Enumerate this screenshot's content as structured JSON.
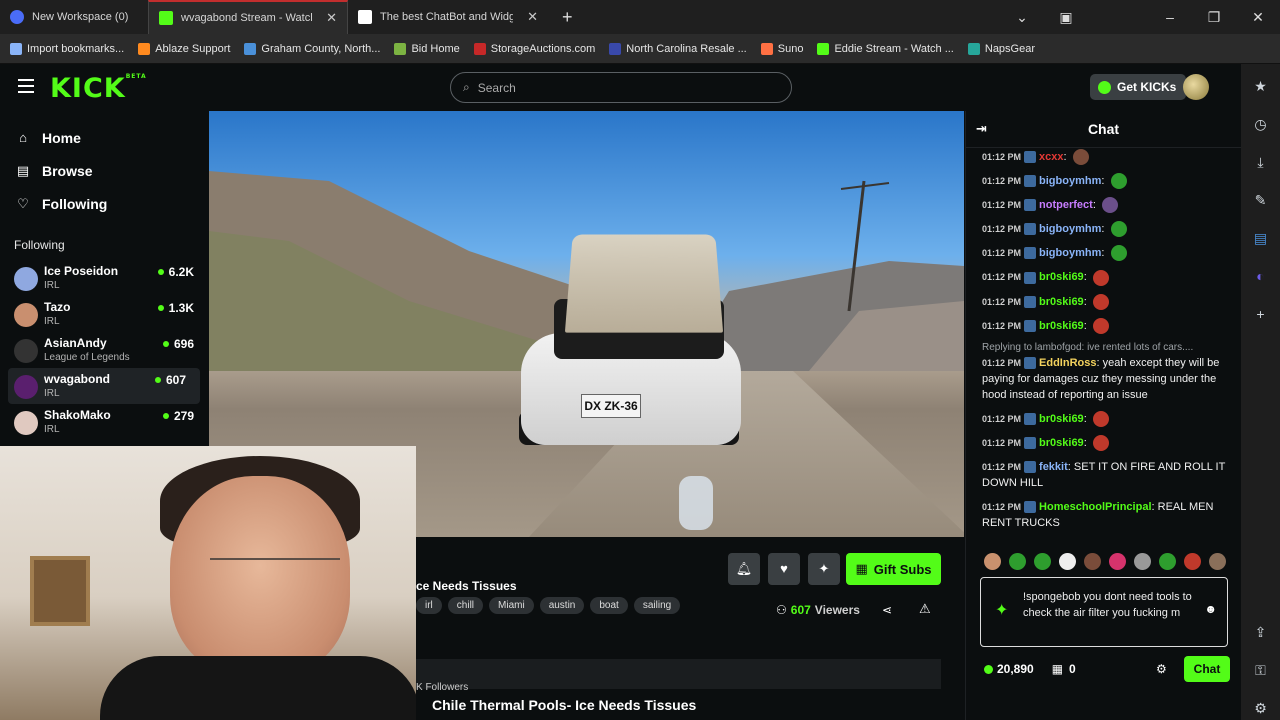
{
  "browser": {
    "tabs": [
      {
        "title": "New Workspace (0)",
        "active": false
      },
      {
        "title": "wvagabond Stream - Watch Liv",
        "active": true
      },
      {
        "title": "The best ChatBot and Widgets fo",
        "active": false
      }
    ],
    "new_tab": "+",
    "bookmarks": [
      {
        "label": "Import bookmarks...",
        "color": "#8ab4f8"
      },
      {
        "label": "Ablaze Support",
        "color": "#ff8a1f"
      },
      {
        "label": "Graham County, North...",
        "color": "#4a90d9"
      },
      {
        "label": "Bid Home",
        "color": "#7cb342"
      },
      {
        "label": "StorageAuctions.com",
        "color": "#c62828"
      },
      {
        "label": "North Carolina Resale ...",
        "color": "#3949ab"
      },
      {
        "label": "Suno",
        "color": "#ff7043"
      },
      {
        "label": "Eddie Stream - Watch ...",
        "color": "#53fc18"
      },
      {
        "label": "NapsGear",
        "color": "#26a69a"
      }
    ]
  },
  "header": {
    "logo": "KICK",
    "logo_sup": "BETA",
    "search_placeholder": "Search",
    "get_kicks": "Get KICKs",
    "accent": "#53fc18"
  },
  "sidebar": {
    "nav": [
      {
        "label": "Home",
        "icon": "home-icon"
      },
      {
        "label": "Browse",
        "icon": "browse-icon"
      },
      {
        "label": "Following",
        "icon": "heart-icon"
      }
    ],
    "following_title": "Following",
    "channels": [
      {
        "name": "Ice Poseidon",
        "category": "IRL",
        "viewers": "6.2K",
        "avatar": "#8fa8e0"
      },
      {
        "name": "Tazo",
        "category": "IRL",
        "viewers": "1.3K",
        "avatar": "#c98f6f"
      },
      {
        "name": "AsianAndy",
        "category": "League of Legends",
        "viewers": "696",
        "avatar": "#333"
      },
      {
        "name": "wvagabond",
        "category": "IRL",
        "viewers": "607",
        "avatar": "#5a1f6e"
      },
      {
        "name": "ShakoMako",
        "category": "IRL",
        "viewers": "279",
        "avatar": "#e0c9c0"
      }
    ]
  },
  "video": {
    "plate": "DX ZK-36"
  },
  "stream": {
    "title_fragment": "ce Needs Tissues",
    "tags": [
      "irl",
      "chill",
      "Miami",
      "austin",
      "boat",
      "sailing"
    ],
    "gift_subs": "Gift Subs",
    "viewers_count": "607",
    "viewers_label": "Viewers",
    "followers_fragment": "K Followers",
    "bottom_title": "Chile Thermal Pools- Ice Needs Tissues"
  },
  "chat": {
    "title": "Chat",
    "messages": [
      {
        "time": "01:12 PM",
        "user": "xcxx",
        "color": "#e53935",
        "text": "",
        "emote": "#7a4c3a"
      },
      {
        "time": "01:12 PM",
        "user": "bigboymhm",
        "color": "#8ab4f8",
        "text": "",
        "emote": "#2e9e2e",
        "sep": ":"
      },
      {
        "time": "01:12 PM",
        "user": "notperfect",
        "color": "#c77dff",
        "text": "",
        "emote": "#6b4f8a",
        "sep": ":"
      },
      {
        "time": "01:12 PM",
        "user": "bigboymhm",
        "color": "#8ab4f8",
        "text": "",
        "emote": "#2e9e2e",
        "sep": ":"
      },
      {
        "time": "01:12 PM",
        "user": "bigboymhm",
        "color": "#8ab4f8",
        "text": "",
        "emote": "#2e9e2e",
        "sep": ":"
      },
      {
        "time": "01:12 PM",
        "user": "br0ski69",
        "color": "#53fc18",
        "text": "",
        "emote": "#c0392b",
        "sep": ":"
      },
      {
        "time": "01:12 PM",
        "user": "br0ski69",
        "color": "#53fc18",
        "text": "",
        "emote": "#c0392b",
        "sep": ":"
      },
      {
        "time": "01:12 PM",
        "user": "br0ski69",
        "color": "#53fc18",
        "text": "",
        "emote": "#c0392b",
        "sep": ":"
      }
    ],
    "reply_note": "Replying to lambofgod: ive rented lots of cars....",
    "message_long": {
      "time": "01:12 PM",
      "user": "EddInRoss",
      "color": "#f4d35e",
      "text": "yeah except they will be paying for damages cuz they messing under the hood instead of reporting an issue"
    },
    "messages_after": [
      {
        "time": "01:12 PM",
        "user": "br0ski69",
        "color": "#53fc18",
        "text": "",
        "sep": ":"
      },
      {
        "time": "01:12 PM",
        "user": "br0ski69",
        "color": "#53fc18",
        "text": "",
        "sep": ":"
      },
      {
        "time": "01:12 PM",
        "user": "fekkit",
        "color": "#8ab4f8",
        "text": "SET IT ON FIRE AND ROLL IT DOWN HILL",
        "sep": ":"
      },
      {
        "time": "01:12 PM",
        "user": "HomeschoolPrincipal",
        "color": "#53fc18",
        "text": "REAL MEN RENT TRUCKS",
        "sep": ":"
      }
    ],
    "input_text": "!spongebob you dont need tools to check the air filter you fucking m",
    "kicks_balance": "20,890",
    "store_count": "0",
    "send_label": "Chat"
  }
}
